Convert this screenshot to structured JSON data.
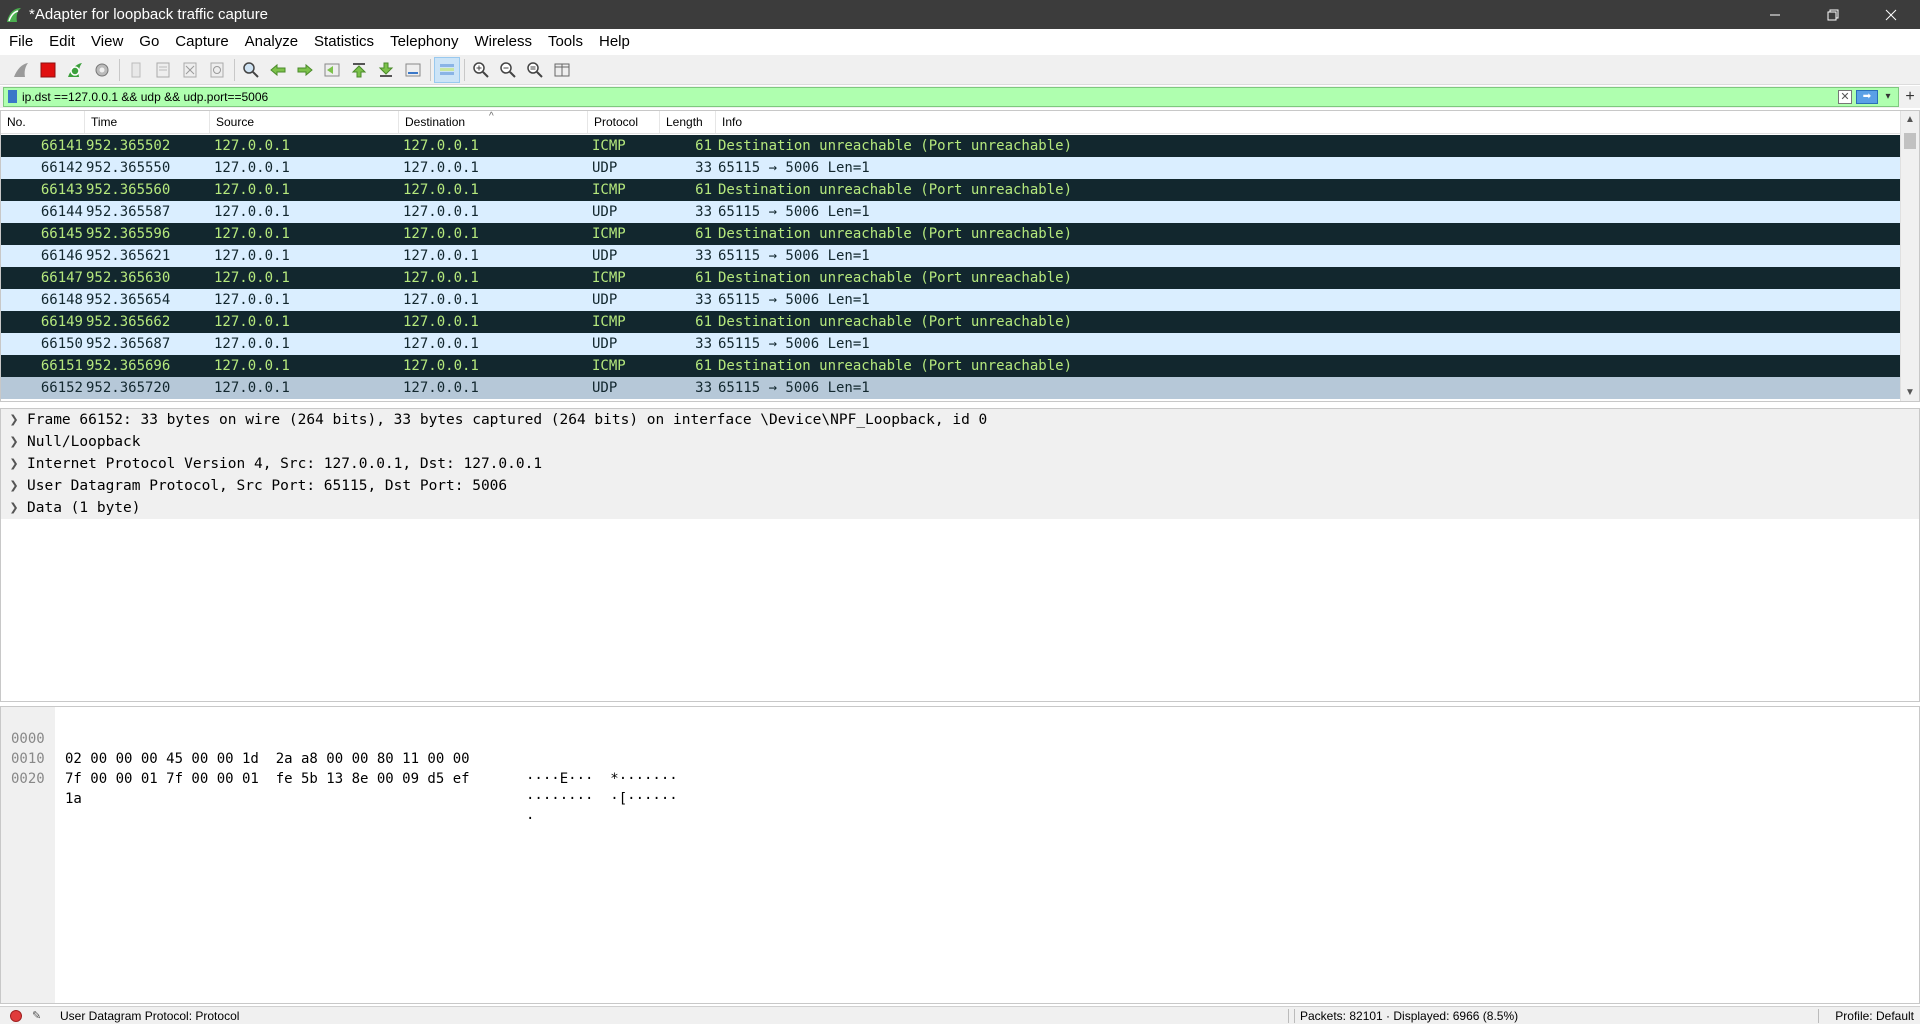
{
  "window": {
    "title": "*Adapter for loopback traffic capture",
    "minimize_glyph": "—",
    "maximize_glyph": "❐",
    "close_glyph": "✕"
  },
  "menu": [
    "File",
    "Edit",
    "View",
    "Go",
    "Capture",
    "Analyze",
    "Statistics",
    "Telephony",
    "Wireless",
    "Tools",
    "Help"
  ],
  "toolbar": {
    "icons": [
      "shark-fin-start-icon",
      "stop-capture-icon",
      "restart-capture-icon",
      "capture-options-icon",
      "open-file-icon",
      "save-file-icon",
      "close-file-icon",
      "reload-file-icon",
      "find-packet-icon",
      "go-back-icon",
      "go-forward-icon",
      "go-to-packet-icon",
      "go-first-packet-icon",
      "go-last-packet-icon",
      "auto-scroll-icon",
      "colorize-icon",
      "zoom-in-icon",
      "zoom-out-icon",
      "zoom-normal-icon",
      "resize-columns-icon"
    ]
  },
  "filter": {
    "value": "ip.dst ==127.0.0.1 && udp && udp.port==5006",
    "clear_glyph": "✕",
    "apply_glyph": "➡",
    "dropdown_glyph": "▾",
    "add_glyph": "+"
  },
  "packet_list": {
    "columns": [
      "No.",
      "Time",
      "Source",
      "Destination",
      "Protocol",
      "Length",
      "Info"
    ],
    "sort_glyph": "^",
    "rows": [
      {
        "no": "66141",
        "time": "952.365502",
        "src": "127.0.0.1",
        "dst": "127.0.0.1",
        "proto": "ICMP",
        "len": "61",
        "info": "Destination unreachable (Port unreachable)"
      },
      {
        "no": "66142",
        "time": "952.365550",
        "src": "127.0.0.1",
        "dst": "127.0.0.1",
        "proto": "UDP",
        "len": "33",
        "info": "65115 → 5006 Len=1"
      },
      {
        "no": "66143",
        "time": "952.365560",
        "src": "127.0.0.1",
        "dst": "127.0.0.1",
        "proto": "ICMP",
        "len": "61",
        "info": "Destination unreachable (Port unreachable)"
      },
      {
        "no": "66144",
        "time": "952.365587",
        "src": "127.0.0.1",
        "dst": "127.0.0.1",
        "proto": "UDP",
        "len": "33",
        "info": "65115 → 5006 Len=1"
      },
      {
        "no": "66145",
        "time": "952.365596",
        "src": "127.0.0.1",
        "dst": "127.0.0.1",
        "proto": "ICMP",
        "len": "61",
        "info": "Destination unreachable (Port unreachable)"
      },
      {
        "no": "66146",
        "time": "952.365621",
        "src": "127.0.0.1",
        "dst": "127.0.0.1",
        "proto": "UDP",
        "len": "33",
        "info": "65115 → 5006 Len=1"
      },
      {
        "no": "66147",
        "time": "952.365630",
        "src": "127.0.0.1",
        "dst": "127.0.0.1",
        "proto": "ICMP",
        "len": "61",
        "info": "Destination unreachable (Port unreachable)"
      },
      {
        "no": "66148",
        "time": "952.365654",
        "src": "127.0.0.1",
        "dst": "127.0.0.1",
        "proto": "UDP",
        "len": "33",
        "info": "65115 → 5006 Len=1"
      },
      {
        "no": "66149",
        "time": "952.365662",
        "src": "127.0.0.1",
        "dst": "127.0.0.1",
        "proto": "ICMP",
        "len": "61",
        "info": "Destination unreachable (Port unreachable)"
      },
      {
        "no": "66150",
        "time": "952.365687",
        "src": "127.0.0.1",
        "dst": "127.0.0.1",
        "proto": "UDP",
        "len": "33",
        "info": "65115 → 5006 Len=1"
      },
      {
        "no": "66151",
        "time": "952.365696",
        "src": "127.0.0.1",
        "dst": "127.0.0.1",
        "proto": "ICMP",
        "len": "61",
        "info": "Destination unreachable (Port unreachable)"
      },
      {
        "no": "66152",
        "time": "952.365720",
        "src": "127.0.0.1",
        "dst": "127.0.0.1",
        "proto": "UDP",
        "len": "33",
        "info": "65115 → 5006 Len=1"
      }
    ],
    "selected_no": "66152",
    "row_colors": {
      "icmp_bg": "#12272e",
      "icmp_fg": "#b5e87d",
      "udp_bg": "#daeeff",
      "selected_bg": "#b6c8d8"
    }
  },
  "details": [
    "Frame 66152: 33 bytes on wire (264 bits), 33 bytes captured (264 bits) on interface \\Device\\NPF_Loopback, id 0",
    "Null/Loopback",
    "Internet Protocol Version 4, Src: 127.0.0.1, Dst: 127.0.0.1",
    "User Datagram Protocol, Src Port: 65115, Dst Port: 5006",
    "Data (1 byte)"
  ],
  "bytes": [
    {
      "offset": "0000",
      "hex": "02 00 00 00 45 00 00 1d  2a a8 00 00 80 11 00 00",
      "ascii": "····E···  *·······"
    },
    {
      "offset": "0010",
      "hex": "7f 00 00 01 7f 00 00 01  fe 5b 13 8e 00 09 d5 ef",
      "ascii": "········  ·[······"
    },
    {
      "offset": "0020",
      "hex": "1a",
      "ascii": "·"
    }
  ],
  "status": {
    "text": "User Datagram Protocol: Protocol",
    "packets": "Packets: 82101 · Displayed: 6966 (8.5%)",
    "profile": "Profile: Default"
  }
}
